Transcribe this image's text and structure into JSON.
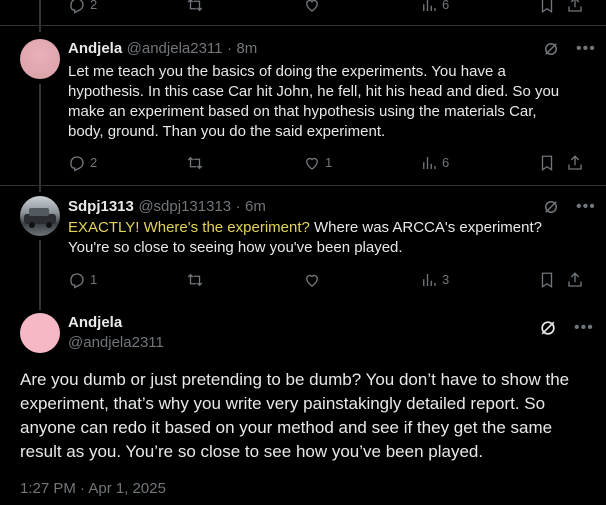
{
  "top_actions": {
    "replies": "2",
    "views": "6"
  },
  "reply1": {
    "display_name": "Andjela",
    "handle": "@andjela2311",
    "time": "8m",
    "text": "Let me teach you the basics of doing the experiments. You have a hypothesis. In this case Car hit John, he fell, hit his head and died. So you make an experiment based on that hypothesis using the materials Car, body, ground. Than you do the said experiment.",
    "replies": "2",
    "likes": "1",
    "views": "6"
  },
  "reply2": {
    "display_name": "Sdpj1313",
    "handle": "@sdpj131313",
    "time": "6m",
    "quote_highlight": "EXACTLY! Where's the experiment?",
    "text_after": " Where was ARCCA's experiment? You're so close to seeing how you've been played.",
    "replies": "1",
    "views": "3"
  },
  "main_post": {
    "display_name": "Andjela",
    "handle": "@andjela2311",
    "text": "Are you dumb or just pretending to be dumb? You don’t have to show the experiment, that’s why you write very painstakingly detailed report. So anyone can redo it based on your method and see if they get the same result as you. You’re so close to see how you’ve been played.",
    "timestamp": "1:27 PM · Apr 1, 2025"
  },
  "colors": {
    "background": "#000000",
    "text": "#e7e9ea",
    "muted": "#71767b",
    "highlight": "#e4d35a",
    "avatar_pink": "#f7b8c6"
  },
  "icons": [
    "reply-icon",
    "retweet-icon",
    "like-icon",
    "views-icon",
    "bookmark-icon",
    "share-icon",
    "grok-icon",
    "more-icon"
  ]
}
